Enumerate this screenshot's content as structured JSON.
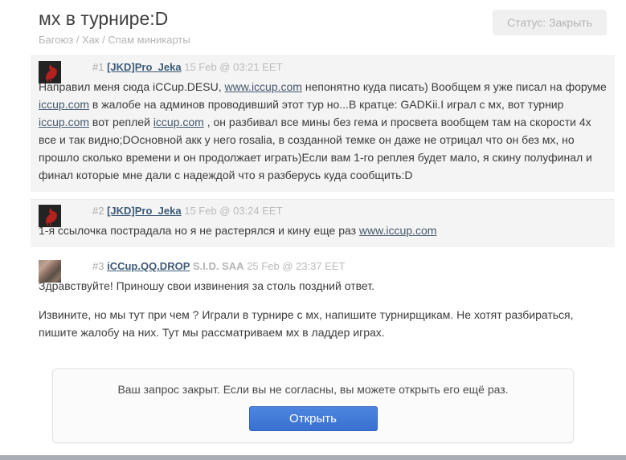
{
  "page": {
    "title": "мх в турнире:D",
    "breadcrumb": "Багоюз / Хак / Спам миникарты",
    "status_button": "Статус: Закрыть"
  },
  "posts": [
    {
      "num": "#1",
      "author": "[JKD]Pro_Jeka",
      "date": "15 Feb @ 03:21 EET",
      "avatar": "liverbird-red-on-dark",
      "body": [
        [
          {
            "t": "text",
            "v": "Направил меня сюда iCCup.DESU, "
          },
          {
            "t": "link",
            "v": "www.iccup.com"
          },
          {
            "t": "text",
            "v": " непонятно куда писать) Вообщем я уже писал на форуме "
          },
          {
            "t": "link",
            "v": "iccup.com"
          },
          {
            "t": "text",
            "v": " в жалобе на админов проводивший этот тур но...В кратце: GADKii.I играл с мх, вот турнир "
          },
          {
            "t": "link",
            "v": "iccup.com"
          },
          {
            "t": "text",
            "v": " вот реплей "
          },
          {
            "t": "link",
            "v": "iccup.com"
          },
          {
            "t": "text",
            "v": " , он разбивал все мины без гема и просвета вообщем там на скорости 4х все и так видно;DОсновной акк у него rosalia, в созданной темке он даже не отрицал что он без мх, но прошло сколько времени и он продолжает играть)Если вам 1-го реплея будет мало, я скину полуфинал и финал которые мне дали с надеждой что я разберусь куда сообщить:D"
          }
        ]
      ]
    },
    {
      "num": "#2",
      "author": "[JKD]Pro_Jeka",
      "date": "15 Feb @ 03:24 EET",
      "avatar": "liverbird-red-on-dark",
      "body": [
        [
          {
            "t": "text",
            "v": "1-я ссылочка пострадала но я не растерялся и кину еще раз "
          },
          {
            "t": "link",
            "v": "www.iccup.com"
          }
        ]
      ]
    },
    {
      "num": "#3",
      "author": "iCCup.QQ.DROP",
      "role": "S.I.D. SAA",
      "date": "25 Feb @ 23:37 EET",
      "avatar": "user-photo-portrait",
      "body": [
        [
          {
            "t": "text",
            "v": "Здравствуйте! Приношу свои извинения за столь поздний ответ."
          }
        ],
        [
          {
            "t": "text",
            "v": "Извините, но мы тут при чем ? Играли в турнире с мх, напишите турнирщикам. Не хотят разбираться, пишите жалобу на них. Тут мы рассматриваем мх в ладдер играх."
          }
        ]
      ]
    }
  ],
  "closed_box": {
    "message": "Ваш запрос закрыт. Если вы не согласны, вы можете открыть его ещё раз.",
    "open_button": "Открыть"
  },
  "colors": {
    "accent_blue": "#3b76d8",
    "post_highlight_bg": "#f4f4f4",
    "link_color": "#44586e",
    "author_link_color": "#3c5a78",
    "status_button_bg": "#f0f0f0",
    "muted_text": "#b4b4b4",
    "body_text": "#3c3c3c",
    "bottom_bar": "#a9aeb6"
  }
}
